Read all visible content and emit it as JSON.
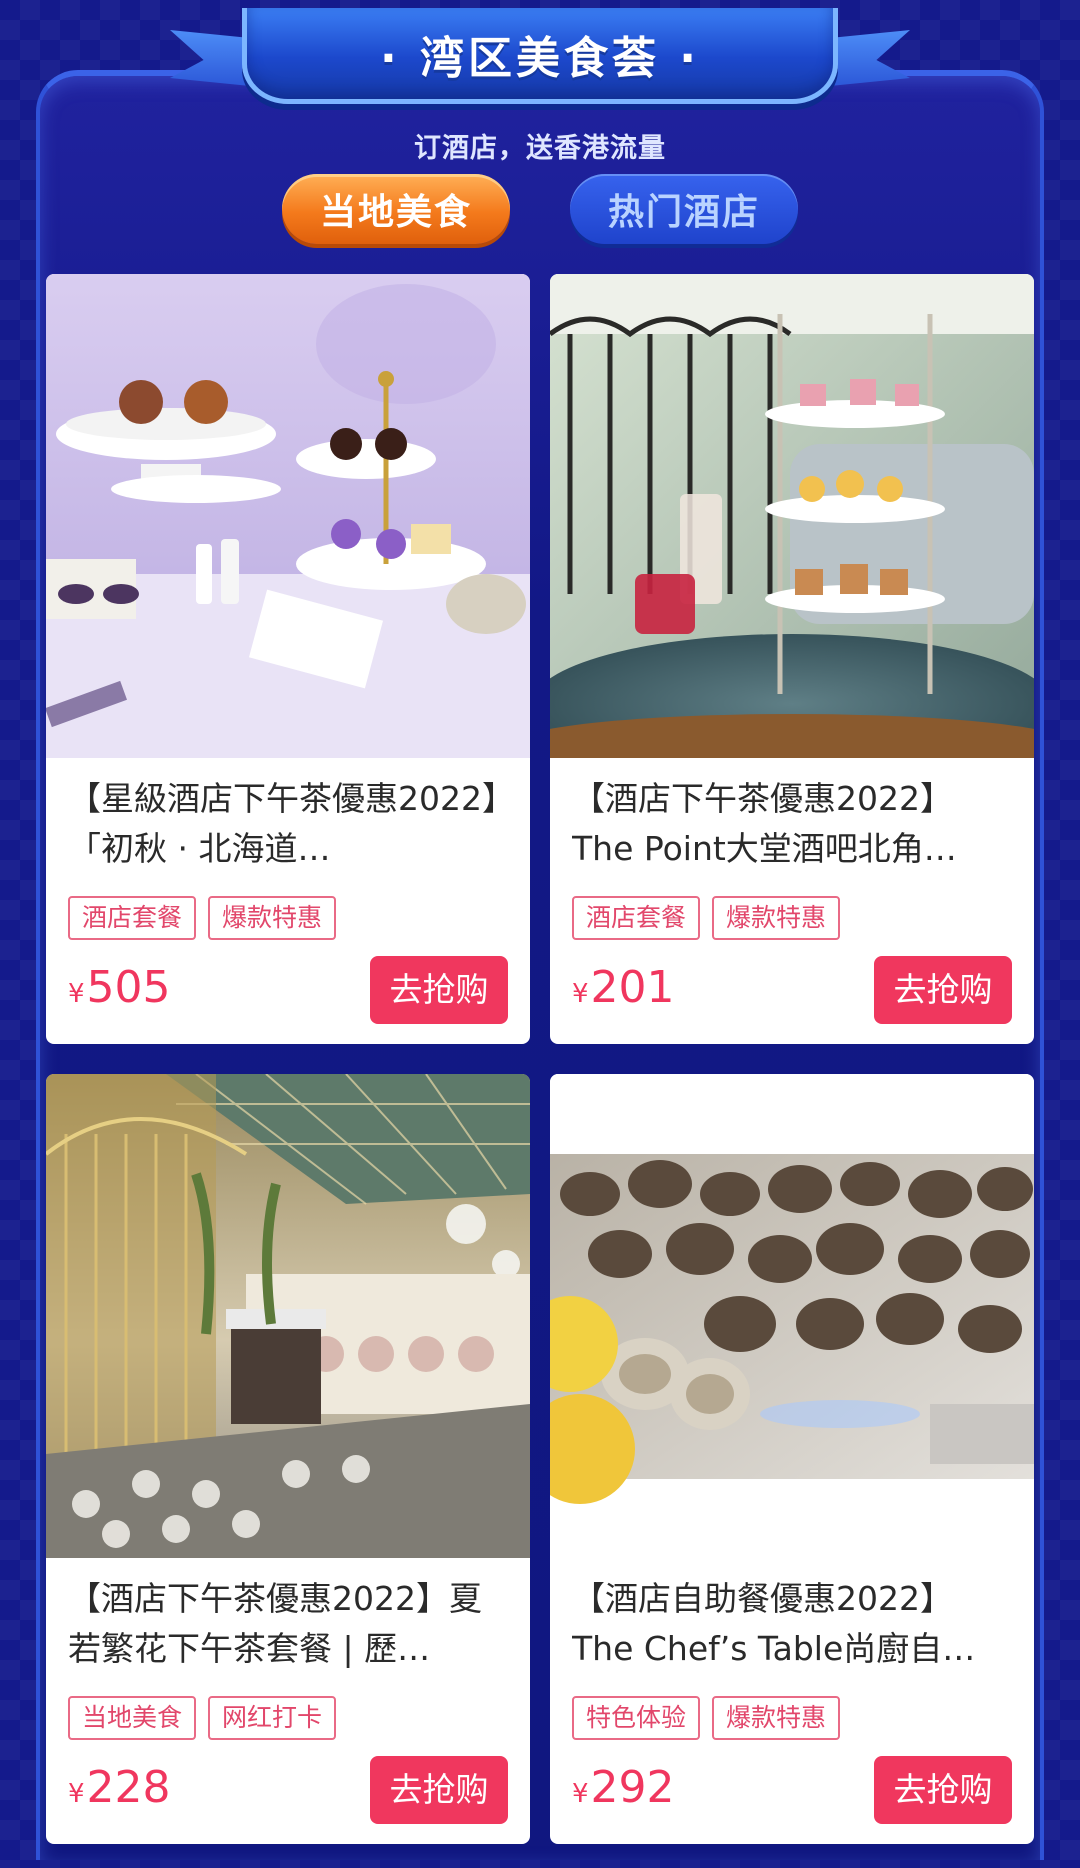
{
  "header": {
    "title": "· 湾区美食荟 ·",
    "subtitle": "订酒店，送香港流量",
    "tabs": [
      {
        "label": "当地美食",
        "active": true
      },
      {
        "label": "热门酒店",
        "active": false
      }
    ]
  },
  "colors": {
    "background": "#141a8c",
    "accent": "#f0375e",
    "tab_active": "#f47a1c",
    "tab_inactive": "#1f43cc"
  },
  "products": [
    {
      "title": "【星級酒店下午茶優惠2022】「初秋 · 北海道…",
      "tags": [
        "酒店套餐",
        "爆款特惠"
      ],
      "currency": "¥",
      "price": "505",
      "button": "去抢购",
      "image": "afternoon-tea-lavender"
    },
    {
      "title": "【酒店下午茶優惠2022】The Point大堂酒吧北角…",
      "tags": [
        "酒店套餐",
        "爆款特惠"
      ],
      "currency": "¥",
      "price": "201",
      "button": "去抢购",
      "image": "afternoon-tea-tower"
    },
    {
      "title": "【酒店下午茶優惠2022】夏若繁花下午茶套餐 | 歷…",
      "tags": [
        "当地美食",
        "网红打卡"
      ],
      "currency": "¥",
      "price": "228",
      "button": "去抢购",
      "image": "cafe-interior"
    },
    {
      "title": "【酒店自助餐優惠2022】The Chef’s Table尚廚自…",
      "tags": [
        "特色体验",
        "爆款特惠"
      ],
      "currency": "¥",
      "price": "292",
      "button": "去抢购",
      "image": "oysters-on-ice"
    }
  ]
}
